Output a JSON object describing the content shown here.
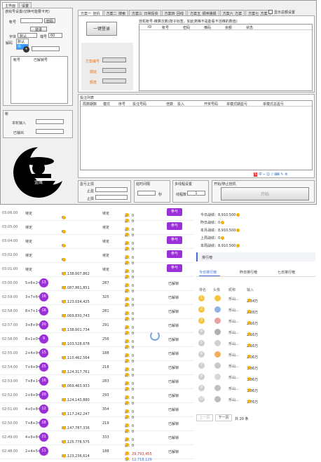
{
  "window": {
    "tabs": [
      "主界面",
      "设置"
    ],
    "left": {
      "group_title": "游戏号设置(切换可能要卡死)",
      "account_label": "帐号",
      "account_value": "",
      "password_button": "密码",
      "login_button": "登录",
      "channel_label": "字体",
      "channel_value": "默认",
      "mode_label": "端号",
      "mode_value": "60",
      "parse_label": "解码",
      "dropdown_options": [
        "默认",
        "中"
      ],
      "list_headers": [
        "帐号",
        "已解锁号"
      ],
      "bottom_group_title": "帐",
      "income_label": "本轮输入",
      "pay_label": "已输出",
      "logo_caption": "金鹰"
    },
    "top_tabs": [
      "方案一_挂机",
      "方案二_搜索",
      "方案三_日常投资",
      "方案四_回线",
      "方案五_顺序播报",
      "方案六_方案",
      "方案七_方案"
    ],
    "show_balance_label": "显示总额设置",
    "one_key_login": "一键登录",
    "plan_labels": [
      "方案编号",
      "顺延",
      "额度"
    ],
    "grid_caption": "挂机帐号-推算次数(按子标签，如此类推不是能看不活推的数值)",
    "grid_headers": [
      "ID",
      "帐号",
      "密码",
      "推码",
      "余额",
      "状态"
    ],
    "result_title": "投注列表",
    "result_headers": [
      "局数期数",
      "模式",
      "序号",
      "投注号码",
      "倍数",
      "投入",
      "开奖号码",
      "单模式期盈亏",
      "单模式总盈亏"
    ],
    "bottom": {
      "pause_title": "盈亏止损",
      "stop_win_label": "止盈",
      "stop_loss_label": "止损",
      "interval_title": "延时间隔",
      "interval_unit": "秒",
      "multi_title": "多线程设置",
      "thread_label": "线程数",
      "thread_value": "1",
      "startstop_title": "开始/停止挂机",
      "start_button": "开始"
    }
  },
  "records": [
    {
      "time": "03:06:00",
      "formula": "",
      "badge": "",
      "id": "待定",
      "amount": "0",
      "bet": "待定",
      "cnt": "",
      "status": "",
      "action": "参与"
    },
    {
      "time": "03:05:00",
      "formula": "",
      "badge": "",
      "id": "待定",
      "amount": "0",
      "bet": "待定",
      "cnt": "",
      "status": "",
      "action": "参与"
    },
    {
      "time": "03:04:00",
      "formula": "",
      "badge": "",
      "id": "待定",
      "amount": "0",
      "bet": "待定",
      "cnt": "",
      "status": "",
      "action": "参与"
    },
    {
      "time": "03:02:00",
      "formula": "",
      "badge": "",
      "id": "待定",
      "amount": "0",
      "bet": "待定",
      "cnt": "",
      "status": "",
      "action": "参与"
    },
    {
      "time": "03:01:00",
      "formula": "",
      "badge": "",
      "id": "待定",
      "amount": "88,138,007,862",
      "bet": "待定",
      "cnt": "",
      "status": "",
      "action": "参与"
    },
    {
      "time": "03:00:00",
      "formula": "5+6+2=",
      "badge": "13",
      "id": "",
      "amount": "88,087,861,851",
      "bet": "",
      "cnt": "287",
      "status": "已解锁",
      "action": ""
    },
    {
      "time": "02:59:00",
      "formula": "3+7+6=",
      "badge": "16",
      "id": "",
      "amount": "88,123,034,425",
      "bet": "",
      "cnt": "325",
      "status": "已解锁",
      "action": ""
    },
    {
      "time": "02:58:00",
      "formula": "8+7+1=",
      "badge": "16",
      "id": "",
      "amount": "88,069,830,743",
      "bet": "",
      "cnt": "281",
      "status": "已解锁",
      "action": ""
    },
    {
      "time": "02:57:00",
      "formula": "3+8+9=",
      "badge": "20",
      "id": "",
      "amount": "88,138,001,734",
      "bet": "",
      "cnt": "291",
      "status": "已解锁",
      "action": ""
    },
    {
      "time": "02:56:00",
      "formula": "8+1+0=",
      "badge": "9",
      "id": "",
      "amount": "88,103,528,678",
      "bet": "",
      "cnt": "256",
      "status": "已解锁",
      "action": ""
    },
    {
      "time": "02:55:00",
      "formula": "2+4+9=",
      "badge": "15",
      "id": "",
      "amount": "88,110,462,564",
      "bet": "",
      "cnt": "188",
      "status": "已解锁",
      "action": ""
    },
    {
      "time": "02:54:00",
      "formula": "7+9+9=",
      "badge": "25",
      "id": "",
      "amount": "88,124,317,761",
      "bet": "",
      "cnt": "218",
      "status": "已解锁",
      "action": ""
    },
    {
      "time": "02:53:00",
      "formula": "7+8+1=",
      "badge": "16",
      "id": "",
      "amount": "88,069,463,933",
      "bet": "",
      "cnt": "283",
      "status": "已解锁",
      "action": ""
    },
    {
      "time": "02:52:00",
      "formula": "2+9+9=",
      "badge": "20",
      "id": "",
      "amount": "88,124,143,880",
      "bet": "",
      "cnt": "293",
      "status": "已解锁",
      "action": ""
    },
    {
      "time": "02:51:00",
      "formula": "4+0+8=",
      "badge": "12",
      "id": "",
      "amount": "88,117,242,247",
      "bet": "",
      "cnt": "354",
      "status": "已解锁",
      "action": ""
    },
    {
      "time": "02:50:00",
      "formula": "7+8+3=",
      "badge": "18",
      "id": "",
      "amount": "88,147,787,336",
      "bet": "",
      "cnt": "219",
      "status": "已解锁",
      "action": ""
    },
    {
      "time": "02:49:00",
      "formula": "4+9+8=",
      "badge": "21",
      "id": "",
      "amount": "88,125,778,575",
      "bet": "",
      "cnt": "333",
      "status": "已解锁",
      "action": ""
    },
    {
      "time": "02:48:00",
      "formula": "2+4+5=",
      "badge": "11",
      "id": "",
      "amount": "88,123,236,614",
      "bet": "",
      "cnt": "188",
      "status": "已解锁",
      "action": ""
    }
  ],
  "bet_lines": {
    "a": "赢：0",
    "b": "赢：0"
  },
  "last_bet": {
    "a": "赢：29,793,455",
    "b": "输：12,718,129"
  },
  "stats": {
    "today": "今日战绩：8,910,500",
    "yesterday": "昨日战绩：0",
    "month": "本月战绩：8,910,500",
    "last_week": "上周战绩：0",
    "this_week": "本周战绩：8,910,500"
  },
  "leaderboard": {
    "title": "排行榜",
    "tabs": [
      "今日排行榜",
      "昨日排行榜",
      "七日排行榜"
    ],
    "headers": [
      "排名",
      "头像",
      "昵称",
      "输入"
    ],
    "rows": [
      {
        "rank": "1",
        "name": "乐山...",
        "value": "2.34万"
      },
      {
        "rank": "2",
        "name": "乐山...",
        "value": "2.28万"
      },
      {
        "rank": "3",
        "name": "乐山...",
        "value": "2.16万"
      },
      {
        "rank": "4",
        "name": "乐山...",
        "value": "2.16万"
      },
      {
        "rank": "5",
        "name": "乐山...",
        "value": "2.16万"
      },
      {
        "rank": "6",
        "name": "乐山...",
        "value": "2.06万"
      },
      {
        "rank": "7",
        "name": "乐山...",
        "value": "1.86万"
      },
      {
        "rank": "8",
        "name": "乐山...",
        "value": "1.86万"
      },
      {
        "rank": "9",
        "name": "乐山...",
        "value": "1.86万"
      },
      {
        "rank": "10",
        "name": "乐山...",
        "value": "1.76万"
      }
    ],
    "prev": "上一页",
    "next": "下一页",
    "total": "共 20 条"
  },
  "colors": {
    "accent": "#9b30d9",
    "coin": "#f0b400",
    "highlight": "#e87722"
  }
}
